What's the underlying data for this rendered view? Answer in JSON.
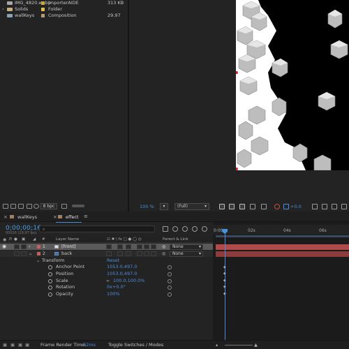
{
  "project": {
    "items": [
      {
        "name": "IMG_4820.webp",
        "type": "ImporterAIDE",
        "size": "313 KB",
        "swatch": "#c7a83a"
      },
      {
        "name": "Solids",
        "type": "Folder",
        "size": "",
        "swatch": "#e2c04a"
      },
      {
        "name": "wallKeys",
        "type": "Composition",
        "size": "29.97",
        "swatch": "#b89a78"
      }
    ],
    "bpc": "8 bpc"
  },
  "viewer": {
    "zoom": "100 %",
    "resolution": "(Full)",
    "exposure": "+0.0"
  },
  "timeline": {
    "tabs": [
      {
        "label": "wallKeys"
      },
      {
        "label": "effect"
      }
    ],
    "timecode": "0;00;00;16",
    "fps": "00016 (29.97 fps)",
    "columns": {
      "num": "#",
      "layer_name": "Layer Name",
      "parent": "Parent & Link"
    },
    "layers": [
      {
        "num": "1",
        "name": "[front]",
        "parent": "None",
        "color": "#c75f5f"
      },
      {
        "num": "2",
        "name": "back",
        "parent": "None",
        "color": "#c75f5f"
      }
    ],
    "transform": {
      "label": "Transform",
      "reset": "Reset",
      "props": [
        {
          "name": "Anchor Point",
          "value": "1053.0,497.0"
        },
        {
          "name": "Position",
          "value": "1053.0,497.0"
        },
        {
          "name": "Scale",
          "value": "100.0,100.0%"
        },
        {
          "name": "Rotation",
          "value": "0x+0.0°"
        },
        {
          "name": "Opacity",
          "value": "100%"
        }
      ]
    },
    "ruler": [
      "0:00s",
      "02s",
      "04s",
      "06s"
    ],
    "status": {
      "render_label": "Frame Render Time:",
      "render_value": "52ms",
      "toggle": "Toggle Switches / Modes"
    }
  },
  "colors": {
    "accent": "#4a8fd9",
    "track_front": "#b14a4a",
    "track_back": "#8d3b3b"
  }
}
